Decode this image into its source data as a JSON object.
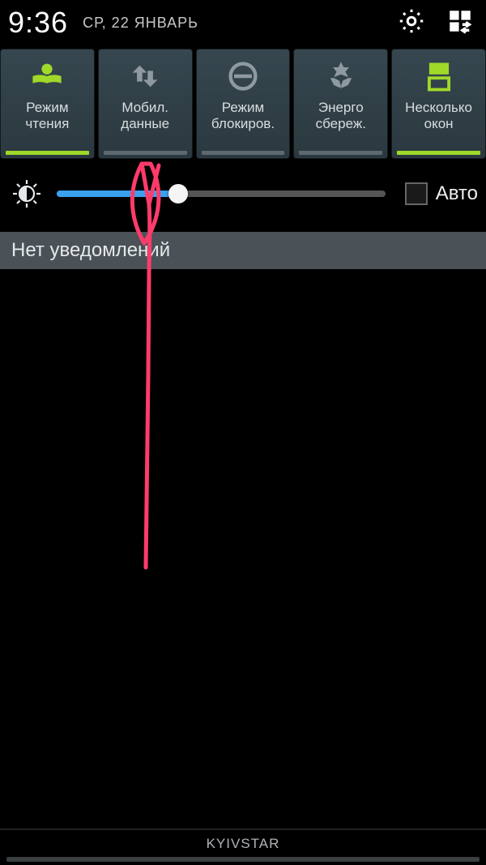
{
  "status": {
    "time": "9:36",
    "date": "СР, 22 ЯНВАРЬ"
  },
  "toggles": [
    {
      "line1": "Режим",
      "line2": "чтения",
      "on": true
    },
    {
      "line1": "Мобил.",
      "line2": "данные",
      "on": false
    },
    {
      "line1": "Режим",
      "line2": "блокиров.",
      "on": false
    },
    {
      "line1": "Энерго",
      "line2": "сбереж.",
      "on": false
    },
    {
      "line1": "Несколько",
      "line2": "окон",
      "on": true
    }
  ],
  "brightness": {
    "percent": 37,
    "auto_label": "Авто",
    "auto_checked": false
  },
  "notifications": {
    "empty_text": "Нет уведомлений"
  },
  "carrier": "KYIVSTAR",
  "colors": {
    "accent_green": "#a0d92a",
    "slider_blue": "#3aa0ef",
    "annotation": "#ff3b6b"
  }
}
